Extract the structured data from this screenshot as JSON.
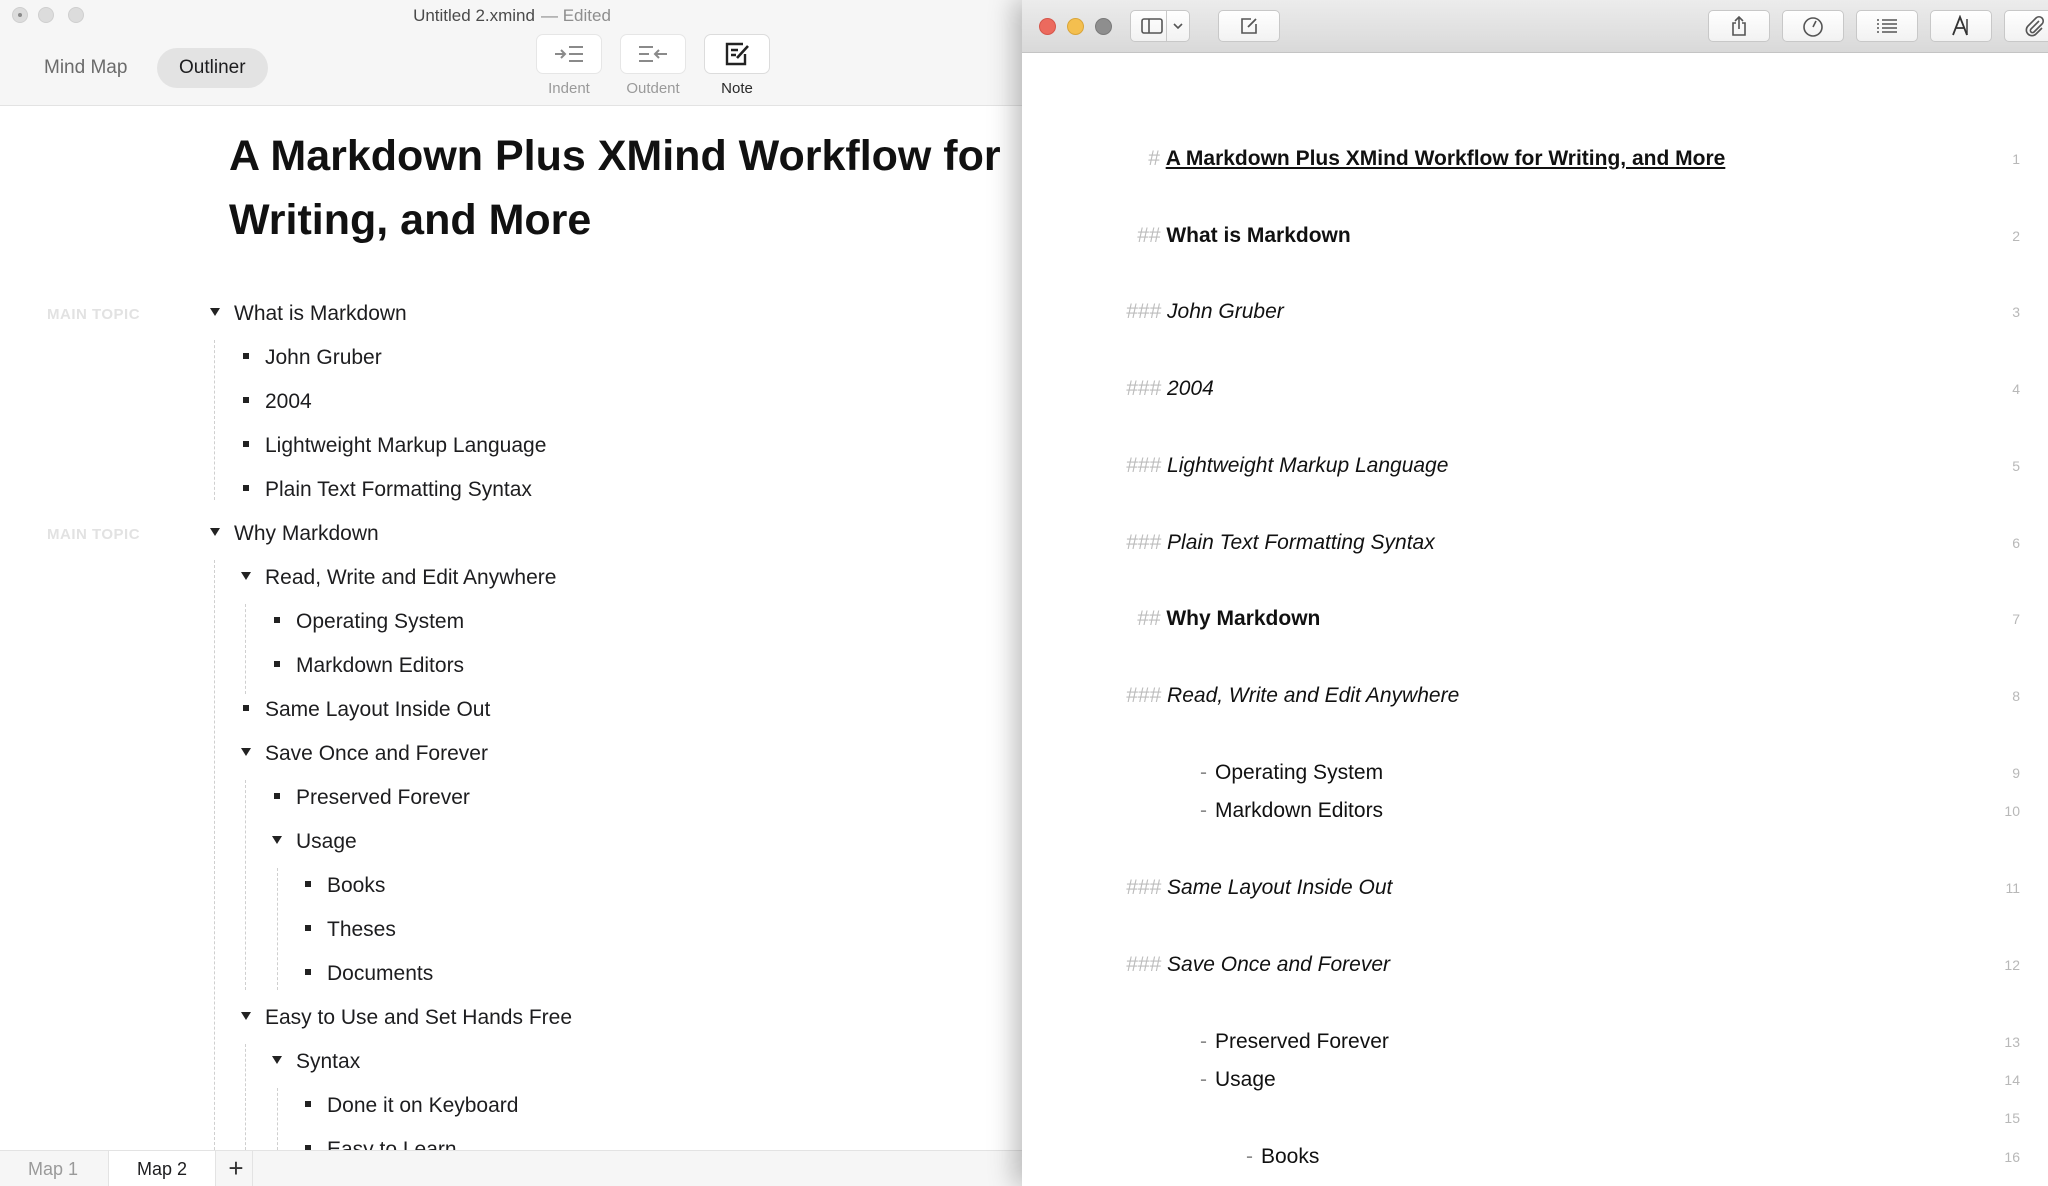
{
  "xmind": {
    "window_title": "Untitled 2.xmind",
    "edited_label": "— Edited",
    "view_tabs": {
      "mind_map": "Mind Map",
      "outliner": "Outliner"
    },
    "tools": {
      "indent": "Indent",
      "outdent": "Outdent",
      "note": "Note"
    },
    "doc_title": "A Markdown Plus XMind Workflow for Writing, and More",
    "main_topic_tag": "MAIN TOPIC",
    "outline": [
      "What is Markdown",
      "John Gruber",
      "2004",
      "Lightweight Markup Language",
      "Plain Text Formatting Syntax",
      "Why Markdown",
      "Read, Write and Edit Anywhere",
      "Operating System",
      "Markdown Editors",
      "Same Layout Inside Out",
      "Save Once and Forever",
      "Preserved Forever",
      "Usage",
      "Books",
      "Theses",
      "Documents",
      "Easy to Use and Set Hands Free",
      "Syntax",
      "Done it on Keyboard",
      "Easy to Learn"
    ],
    "map_tabs": {
      "map1": "Map 1",
      "map2": "Map 2",
      "add": "+"
    }
  },
  "markdown": {
    "lines": [
      {
        "prefix": "#",
        "text": "A Markdown Plus XMind Workflow for Writing, and More",
        "num": "1"
      },
      {
        "prefix": "##",
        "text": "What is Markdown",
        "num": "2"
      },
      {
        "prefix": "###",
        "text": "John Gruber",
        "num": "3"
      },
      {
        "prefix": "###",
        "text": "2004",
        "num": "4"
      },
      {
        "prefix": "###",
        "text": "Lightweight Markup Language",
        "num": "5"
      },
      {
        "prefix": "###",
        "text": "Plain Text Formatting Syntax",
        "num": "6"
      },
      {
        "prefix": "##",
        "text": "Why Markdown",
        "num": "7"
      },
      {
        "prefix": "###",
        "text": "Read, Write and Edit Anywhere",
        "num": "8"
      },
      {
        "prefix": "-",
        "text": "Operating System",
        "num": "9"
      },
      {
        "prefix": "-",
        "text": "Markdown Editors",
        "num": "10"
      },
      {
        "prefix": "###",
        "text": "Same Layout Inside Out",
        "num": "11"
      },
      {
        "prefix": "###",
        "text": "Save Once and Forever",
        "num": "12"
      },
      {
        "prefix": "-",
        "text": "Preserved Forever",
        "num": "13"
      },
      {
        "prefix": "-",
        "text": "Usage",
        "num": "14"
      },
      {
        "prefix": "",
        "text": "",
        "num": "15"
      },
      {
        "prefix": "-",
        "text": "Books",
        "num": "16"
      }
    ]
  },
  "colors": {
    "light_close": "#ec6a5e",
    "light_min": "#f4bf4f",
    "light_zoom": "#8e8e8e"
  }
}
